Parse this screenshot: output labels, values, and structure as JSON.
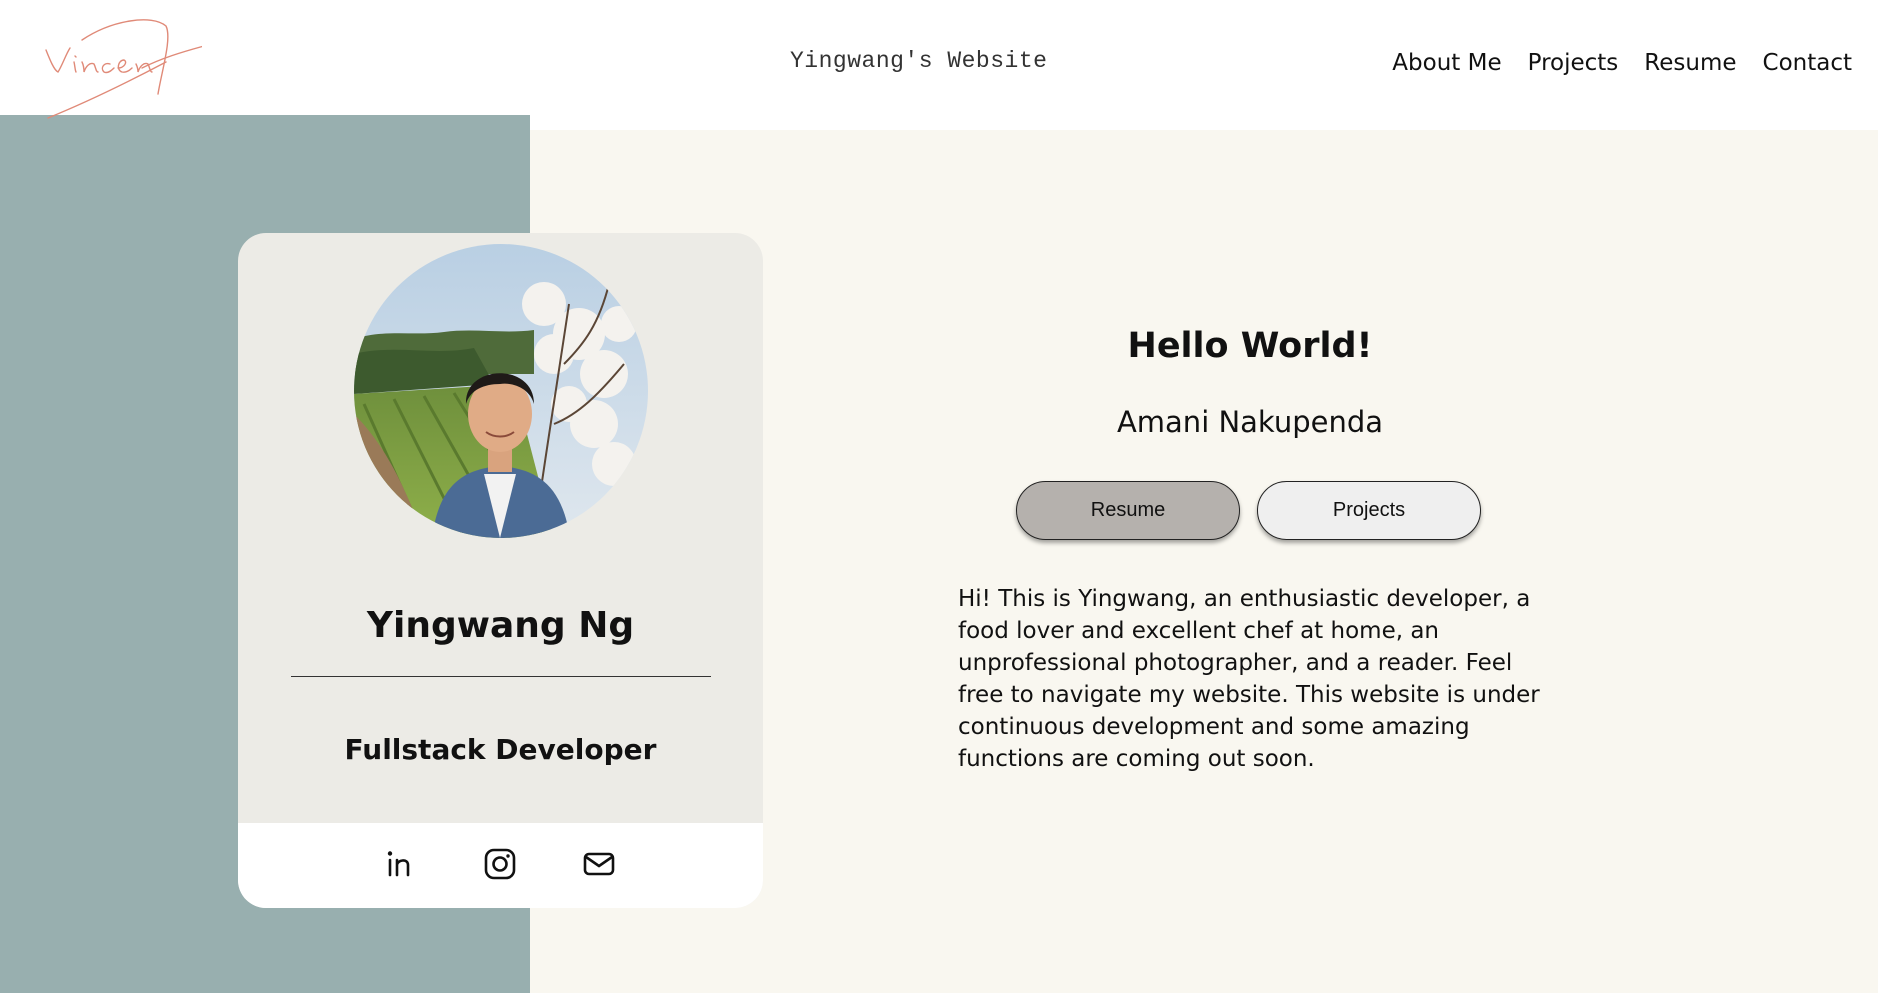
{
  "header": {
    "logo_text": "Vincent",
    "site_title": "Yingwang's Website",
    "nav": [
      {
        "label": "About Me"
      },
      {
        "label": "Projects"
      },
      {
        "label": "Resume"
      },
      {
        "label": "Contact"
      }
    ]
  },
  "profile_card": {
    "avatar_alt": "profile-photo",
    "name": "Yingwang Ng",
    "role": "Fullstack Developer",
    "social": [
      {
        "icon": "linkedin-icon"
      },
      {
        "icon": "instagram-icon"
      },
      {
        "icon": "mail-icon"
      }
    ]
  },
  "hero": {
    "title": "Hello World!",
    "subtitle": "Amani Nakupenda",
    "buttons": {
      "resume_label": "Resume",
      "projects_label": "Projects"
    },
    "bio": "Hi! This is Yingwang, an enthusiastic developer, a food lover and excellent chef at home, an unprofessional photographer, and a reader. Feel free to navigate my website. This website is under continuous development and some amazing functions are coming out soon."
  },
  "colors": {
    "left_panel": "#98afaf",
    "right_panel": "#f9f7f0",
    "card": "#ecebe6",
    "logo_stroke": "#e08a78",
    "resume_button": "#b5b1ad",
    "projects_button": "#efefef"
  }
}
